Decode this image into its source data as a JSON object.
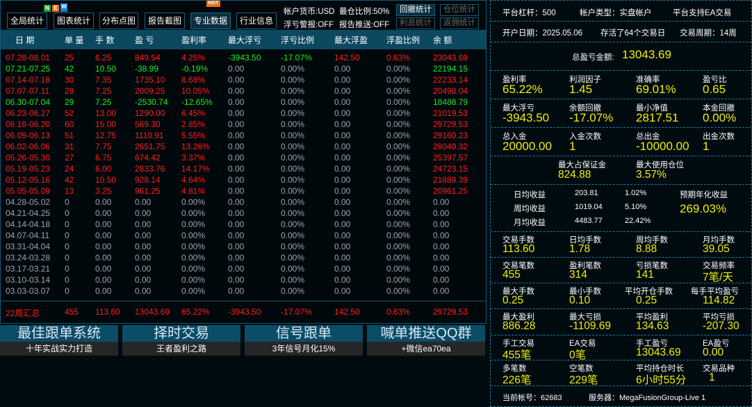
{
  "toolbar": {
    "buttons": [
      "全局统计",
      "图表统计",
      "分布点图",
      "报告截图",
      "专业数据",
      "行业信息"
    ],
    "new_badge": [
      "N",
      "E",
      "W"
    ],
    "hot_badge": "HOT",
    "currency": "帐户货币:USD",
    "max_ratio": "最仓比例:50%",
    "float_alert": "浮亏警报:OFF",
    "report_push": "报告推送:OFF",
    "side_buttons": [
      "回撤统计",
      "仓位统计",
      "利息统计",
      "返佣统计"
    ]
  },
  "table": {
    "headers": [
      "日 期",
      "单 量",
      "手 数",
      "盈 亏",
      "盈利率",
      "最大浮亏",
      "浮亏比例",
      "最大浮盈",
      "浮盈比例",
      "余 额"
    ],
    "rows": [
      {
        "c": "red",
        "v": [
          "07.28-08.01",
          "25",
          "6.25",
          "849.54",
          "4.25%",
          "-3943.50",
          "-17.07%",
          "142.50",
          "0.63%",
          "23043.69"
        ],
        "mc": [
          "green",
          "green",
          "red",
          "red"
        ]
      },
      {
        "c": "green",
        "v": [
          "07.21-07.25",
          "42",
          "10.50",
          "-38.99",
          "-0.19%",
          "0.00",
          "0.00%",
          "0.00",
          "0.00%",
          "22194.15"
        ]
      },
      {
        "c": "red",
        "v": [
          "07.14-07.18",
          "30",
          "7.35",
          "1735.10",
          "8.68%",
          "0.00",
          "0.00%",
          "0.00",
          "0.00%",
          "22233.14"
        ]
      },
      {
        "c": "red",
        "v": [
          "07.07-07.11",
          "29",
          "7.25",
          "2009.25",
          "10.05%",
          "0.00",
          "0.00%",
          "0.00",
          "0.00%",
          "20498.04"
        ]
      },
      {
        "c": "green",
        "v": [
          "06.30-07.04",
          "29",
          "7.25",
          "-2530.74",
          "-12.65%",
          "0.00",
          "0.00%",
          "0.00",
          "0.00%",
          "18488.79"
        ]
      },
      {
        "c": "red",
        "v": [
          "06.23-06.27",
          "52",
          "13.00",
          "1290.00",
          "6.45%",
          "0.00",
          "0.00%",
          "0.00",
          "0.00%",
          "21019.53"
        ]
      },
      {
        "c": "red",
        "v": [
          "06.16-06.20",
          "60",
          "15.00",
          "569.30",
          "2.85%",
          "0.00",
          "0.00%",
          "0.00",
          "0.00%",
          "29729.53"
        ]
      },
      {
        "c": "red",
        "v": [
          "06.09-06.13",
          "51",
          "12.75",
          "1110.91",
          "5.55%",
          "0.00",
          "0.00%",
          "0.00",
          "0.00%",
          "29160.23"
        ]
      },
      {
        "c": "red",
        "v": [
          "06.02-06.06",
          "31",
          "7.75",
          "2651.75",
          "13.26%",
          "0.00",
          "0.00%",
          "0.00",
          "0.00%",
          "28049.32"
        ]
      },
      {
        "c": "red",
        "v": [
          "05.26-05.30",
          "27",
          "6.75",
          "674.42",
          "3.37%",
          "0.00",
          "0.00%",
          "0.00",
          "0.00%",
          "25397.57"
        ]
      },
      {
        "c": "red",
        "v": [
          "05.19-05.23",
          "24",
          "6.00",
          "2833.76",
          "14.17%",
          "0.00",
          "0.00%",
          "0.00",
          "0.00%",
          "24723.15"
        ]
      },
      {
        "c": "red",
        "v": [
          "05.12-05.16",
          "42",
          "10.50",
          "928.14",
          "4.64%",
          "0.00",
          "0.00%",
          "0.00",
          "0.00%",
          "21889.39"
        ]
      },
      {
        "c": "red",
        "v": [
          "05.05-05.09",
          "13",
          "3.25",
          "961.25",
          "4.81%",
          "0.00",
          "0.00%",
          "0.00",
          "0.00%",
          "20961.25"
        ]
      },
      {
        "c": "gray",
        "v": [
          "04.28-05.02",
          "0",
          "0.00",
          "0.00",
          "0.00%",
          "0.00",
          "0.00%",
          "0.00",
          "0.00%",
          "0.00"
        ]
      },
      {
        "c": "gray",
        "v": [
          "04.21-04.25",
          "0",
          "0.00",
          "0.00",
          "0.00%",
          "0.00",
          "0.00%",
          "0.00",
          "0.00%",
          "0.00"
        ]
      },
      {
        "c": "gray",
        "v": [
          "04.14-04.18",
          "0",
          "0.00",
          "0.00",
          "0.00%",
          "0.00",
          "0.00%",
          "0.00",
          "0.00%",
          "0.00"
        ]
      },
      {
        "c": "gray",
        "v": [
          "04.07-04.11",
          "0",
          "0.00",
          "0.00",
          "0.00%",
          "0.00",
          "0.00%",
          "0.00",
          "0.00%",
          "0.00"
        ]
      },
      {
        "c": "gray",
        "v": [
          "03.31-04.04",
          "0",
          "0.00",
          "0.00",
          "0.00%",
          "0.00",
          "0.00%",
          "0.00",
          "0.00%",
          "0.00"
        ]
      },
      {
        "c": "gray",
        "v": [
          "03.24-03.28",
          "0",
          "0.00",
          "0.00",
          "0.00%",
          "0.00",
          "0.00%",
          "0.00",
          "0.00%",
          "0.00"
        ]
      },
      {
        "c": "gray",
        "v": [
          "03.17-03.21",
          "0",
          "0.00",
          "0.00",
          "0.00%",
          "0.00",
          "0.00%",
          "0.00",
          "0.00%",
          "0.00"
        ]
      },
      {
        "c": "gray",
        "v": [
          "03.10-03.14",
          "0",
          "0.00",
          "0.00",
          "0.00%",
          "0.00",
          "0.00%",
          "0.00",
          "0.00%",
          "0.00"
        ]
      },
      {
        "c": "gray",
        "v": [
          "03.03-03.07",
          "0",
          "0.00",
          "0.00",
          "0.00%",
          "0.00",
          "0.00%",
          "0.00",
          "0.00%",
          "0.00"
        ]
      }
    ],
    "summary": [
      "22周汇总",
      "455",
      "113.60",
      "13043.69",
      "65.22%",
      "-3943.50",
      "-17.07%",
      "142.50",
      "0.63%",
      "29729.53"
    ]
  },
  "banners": [
    {
      "title": "最佳跟单系统",
      "sub": "十年实战实力打造"
    },
    {
      "title": "择时交易",
      "sub": "王者盈利之路"
    },
    {
      "title": "信号跟单",
      "sub": "3年信号月化15%"
    },
    {
      "title": "喊单推送QQ群",
      "sub": "+微信ea70ea"
    }
  ],
  "right": {
    "leverage": "平台杠杆：500",
    "acct_type": "帐户类型：实盘帐户",
    "ea_support": "平台支持EA交易",
    "open_date": "开户日期：2025.05.06",
    "alive": "存活了64个交易日",
    "period": "交易周期：14周",
    "total_pl_label": "总盈亏金额:",
    "total_pl": "13043.69",
    "grid1": [
      {
        "l": "盈利率",
        "v": "65.22%"
      },
      {
        "l": "利润因子",
        "v": "1.45"
      },
      {
        "l": "准确率",
        "v": "69.01%"
      },
      {
        "l": "盈亏比",
        "v": "0.65"
      }
    ],
    "grid2": [
      {
        "l": "最大浮亏",
        "v": "-3943.50"
      },
      {
        "l": "余额回撤",
        "v": "-17.07%"
      },
      {
        "l": "最小净值",
        "v": "2817.51"
      },
      {
        "l": "本金回撤",
        "v": "0.00%"
      }
    ],
    "grid3": [
      {
        "l": "总入金",
        "v": "20000.00"
      },
      {
        "l": "入金次数",
        "v": "1"
      },
      {
        "l": "总出金",
        "v": "-10000.00"
      },
      {
        "l": "出金次数",
        "v": "1"
      }
    ],
    "margin": {
      "l": "最大占保证金",
      "v": "824.88"
    },
    "position": {
      "l": "最大使用仓位",
      "v": "3.57%"
    },
    "avg": [
      {
        "l": "日均收益",
        "a": "203.81",
        "p": "1.02%"
      },
      {
        "l": "周均收益",
        "a": "1019.04",
        "p": "5.10%"
      },
      {
        "l": "月均收益",
        "a": "4483.77",
        "p": "22.42%"
      }
    ],
    "annual_label": "预期年化收益",
    "annual": "269.03%",
    "grid4": [
      {
        "l": "交易手数",
        "v": "113.60"
      },
      {
        "l": "日均手数",
        "v": "1.78"
      },
      {
        "l": "周均手数",
        "v": "8.88"
      },
      {
        "l": "月均手数",
        "v": "39.05"
      }
    ],
    "grid5": [
      {
        "l": "交易笔数",
        "v": "455"
      },
      {
        "l": "盈利笔数",
        "v": "314"
      },
      {
        "l": "亏损笔数",
        "v": "141"
      },
      {
        "l": "交易频率",
        "v": "7笔/天"
      }
    ],
    "grid6": [
      {
        "l": "最大手数",
        "v": "0.25"
      },
      {
        "l": "最小手数",
        "v": "0.10"
      },
      {
        "l": "平均开仓手数",
        "v": "0.25"
      },
      {
        "l": "每手平均盈亏",
        "v": "114.82"
      }
    ],
    "grid7": [
      {
        "l": "最大盈利",
        "v": "886.28"
      },
      {
        "l": "最大亏损",
        "v": "-1109.69"
      },
      {
        "l": "平均盈利",
        "v": "134.63"
      },
      {
        "l": "平均亏损",
        "v": "-207.30"
      }
    ],
    "grid8": [
      {
        "l": "手工交易",
        "v": "455笔"
      },
      {
        "l": "EA交易",
        "v": "0笔"
      },
      {
        "l": "手工盈亏",
        "v": "13043.69"
      },
      {
        "l": "EA盈亏",
        "v": "0.00"
      }
    ],
    "grid9": [
      {
        "l": "多笔数",
        "v": "226笔"
      },
      {
        "l": "空笔数",
        "v": "229笔"
      },
      {
        "l": "平均持仓时长",
        "v": "6小时55分"
      },
      {
        "l": "交易品种",
        "v": "1"
      }
    ],
    "account": "当前帐号：62683",
    "server": "服务器：MegaFusionGroup-Live 1"
  }
}
